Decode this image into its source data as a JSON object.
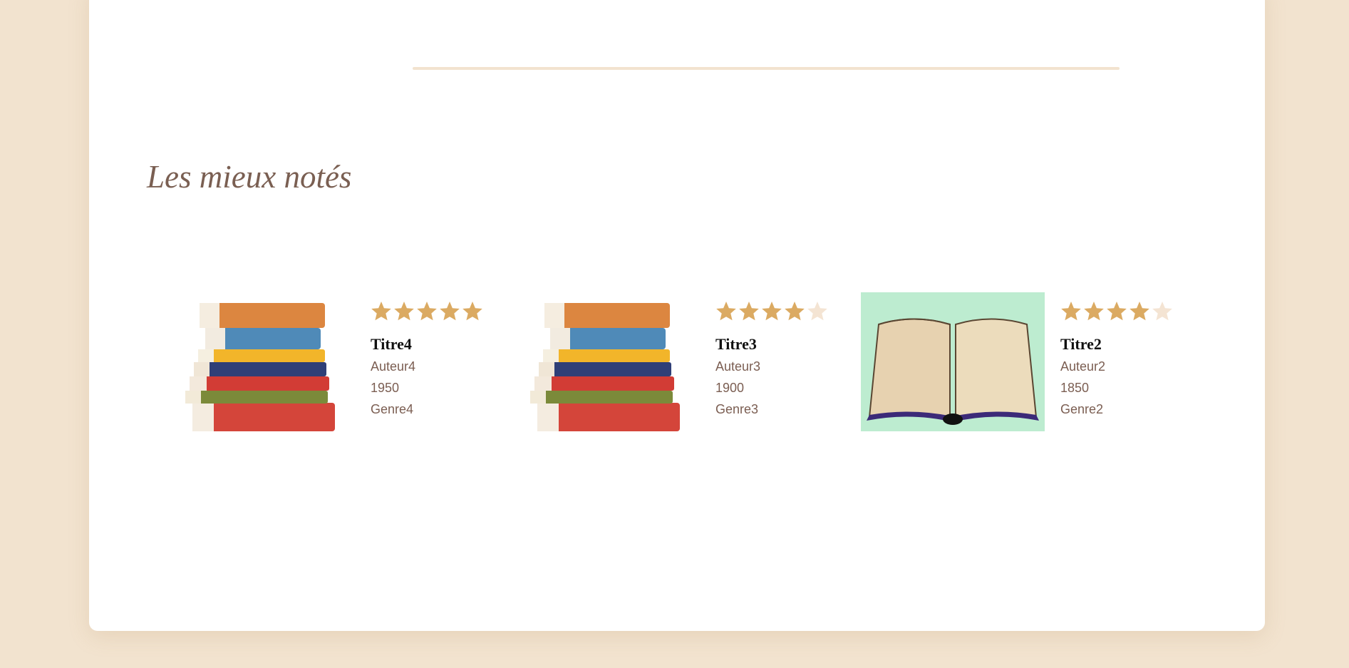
{
  "section": {
    "title": "Les mieux notés"
  },
  "colors": {
    "star_on": "#dbaa62",
    "star_off": "#f4e4d3",
    "accent": "#f2e3cf",
    "text": "#7b5e52"
  },
  "books": [
    {
      "title": "Titre4",
      "author": "Auteur4",
      "year": "1950",
      "genre": "Genre4",
      "rating": 5,
      "cover": "book-stack-icon"
    },
    {
      "title": "Titre3",
      "author": "Auteur3",
      "year": "1900",
      "genre": "Genre3",
      "rating": 4,
      "cover": "book-stack-icon"
    },
    {
      "title": "Titre2",
      "author": "Auteur2",
      "year": "1850",
      "genre": "Genre2",
      "rating": 4,
      "cover": "open-book-icon"
    }
  ]
}
